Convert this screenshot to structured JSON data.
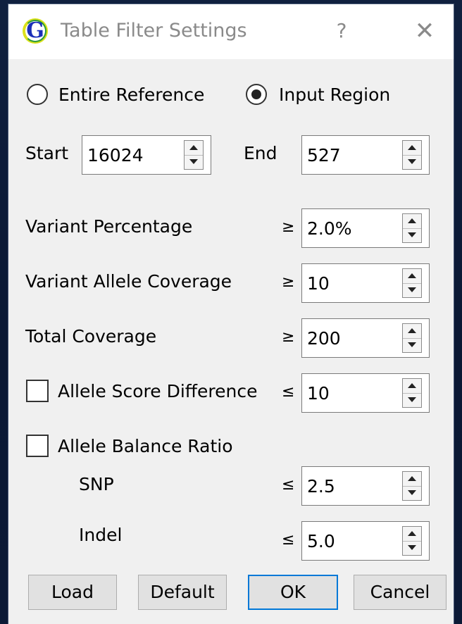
{
  "window": {
    "title": "Table Filter Settings",
    "app_icon_letter": "G",
    "help_label": "?",
    "close_label": "✕"
  },
  "scope": {
    "options": [
      {
        "label": "Entire Reference",
        "selected": false
      },
      {
        "label": "Input Region",
        "selected": true
      }
    ]
  },
  "region": {
    "start_label": "Start",
    "start_value": "16024",
    "end_label": "End",
    "end_value": "527"
  },
  "filters": {
    "variant_percentage": {
      "label": "Variant Percentage",
      "operator": "≥",
      "value": "2.0%"
    },
    "variant_allele_coverage": {
      "label": "Variant Allele Coverage",
      "operator": "≥",
      "value": "10"
    },
    "total_coverage": {
      "label": "Total Coverage",
      "operator": "≥",
      "value": "200"
    },
    "allele_score_difference": {
      "label": "Allele Score Difference",
      "checked": false,
      "operator": "≤",
      "value": "10"
    },
    "allele_balance_ratio": {
      "label": "Allele Balance Ratio",
      "checked": false,
      "snp": {
        "label": "SNP",
        "operator": "≤",
        "value": "2.5"
      },
      "indel": {
        "label": "Indel",
        "operator": "≤",
        "value": "5.0"
      }
    }
  },
  "buttons": {
    "load": "Load",
    "default": "Default",
    "ok": "OK",
    "cancel": "Cancel"
  },
  "colors": {
    "dialog_bg": "#f0f0f0",
    "titlebar_bg": "#ffffff",
    "title_text": "#8a8a8a",
    "default_button_border": "#0078d7",
    "app_icon_letter": "#1b2fb8"
  }
}
